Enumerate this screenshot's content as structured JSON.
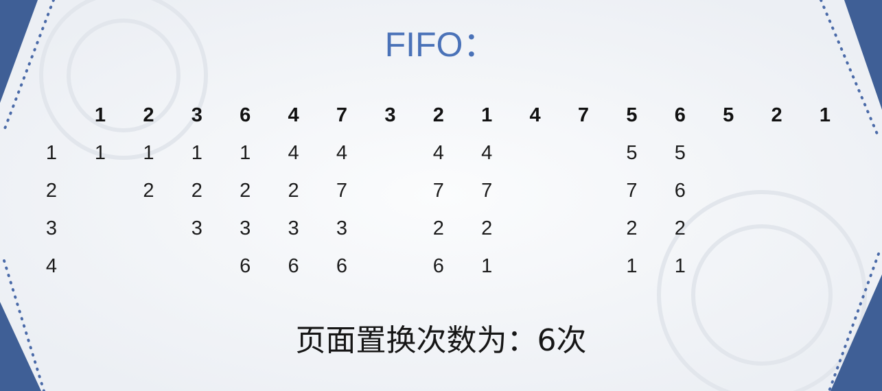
{
  "title": "FIFO：",
  "reference_string": [
    "1",
    "2",
    "3",
    "6",
    "4",
    "7",
    "3",
    "2",
    "1",
    "4",
    "7",
    "5",
    "6",
    "5",
    "2",
    "1"
  ],
  "frame_labels": [
    "1",
    "2",
    "3",
    "4"
  ],
  "frames": [
    [
      "1",
      "1",
      "1",
      "1",
      "4",
      "4",
      "",
      "4",
      "4",
      "",
      "",
      "5",
      "5",
      "",
      "",
      ""
    ],
    [
      "",
      "2",
      "2",
      "2",
      "2",
      "7",
      "",
      "7",
      "7",
      "",
      "",
      "7",
      "6",
      "",
      "",
      ""
    ],
    [
      "",
      "",
      "3",
      "3",
      "3",
      "3",
      "",
      "2",
      "2",
      "",
      "",
      "2",
      "2",
      "",
      "",
      ""
    ],
    [
      "",
      "",
      "",
      "6",
      "6",
      "6",
      "",
      "6",
      "1",
      "",
      "",
      "1",
      "1",
      "",
      "",
      ""
    ]
  ],
  "summary": "页面置换次数为：6次",
  "colors": {
    "title": "#4a72b8",
    "frame_border": "#3f5f96",
    "dots": "#4a6aa8"
  }
}
